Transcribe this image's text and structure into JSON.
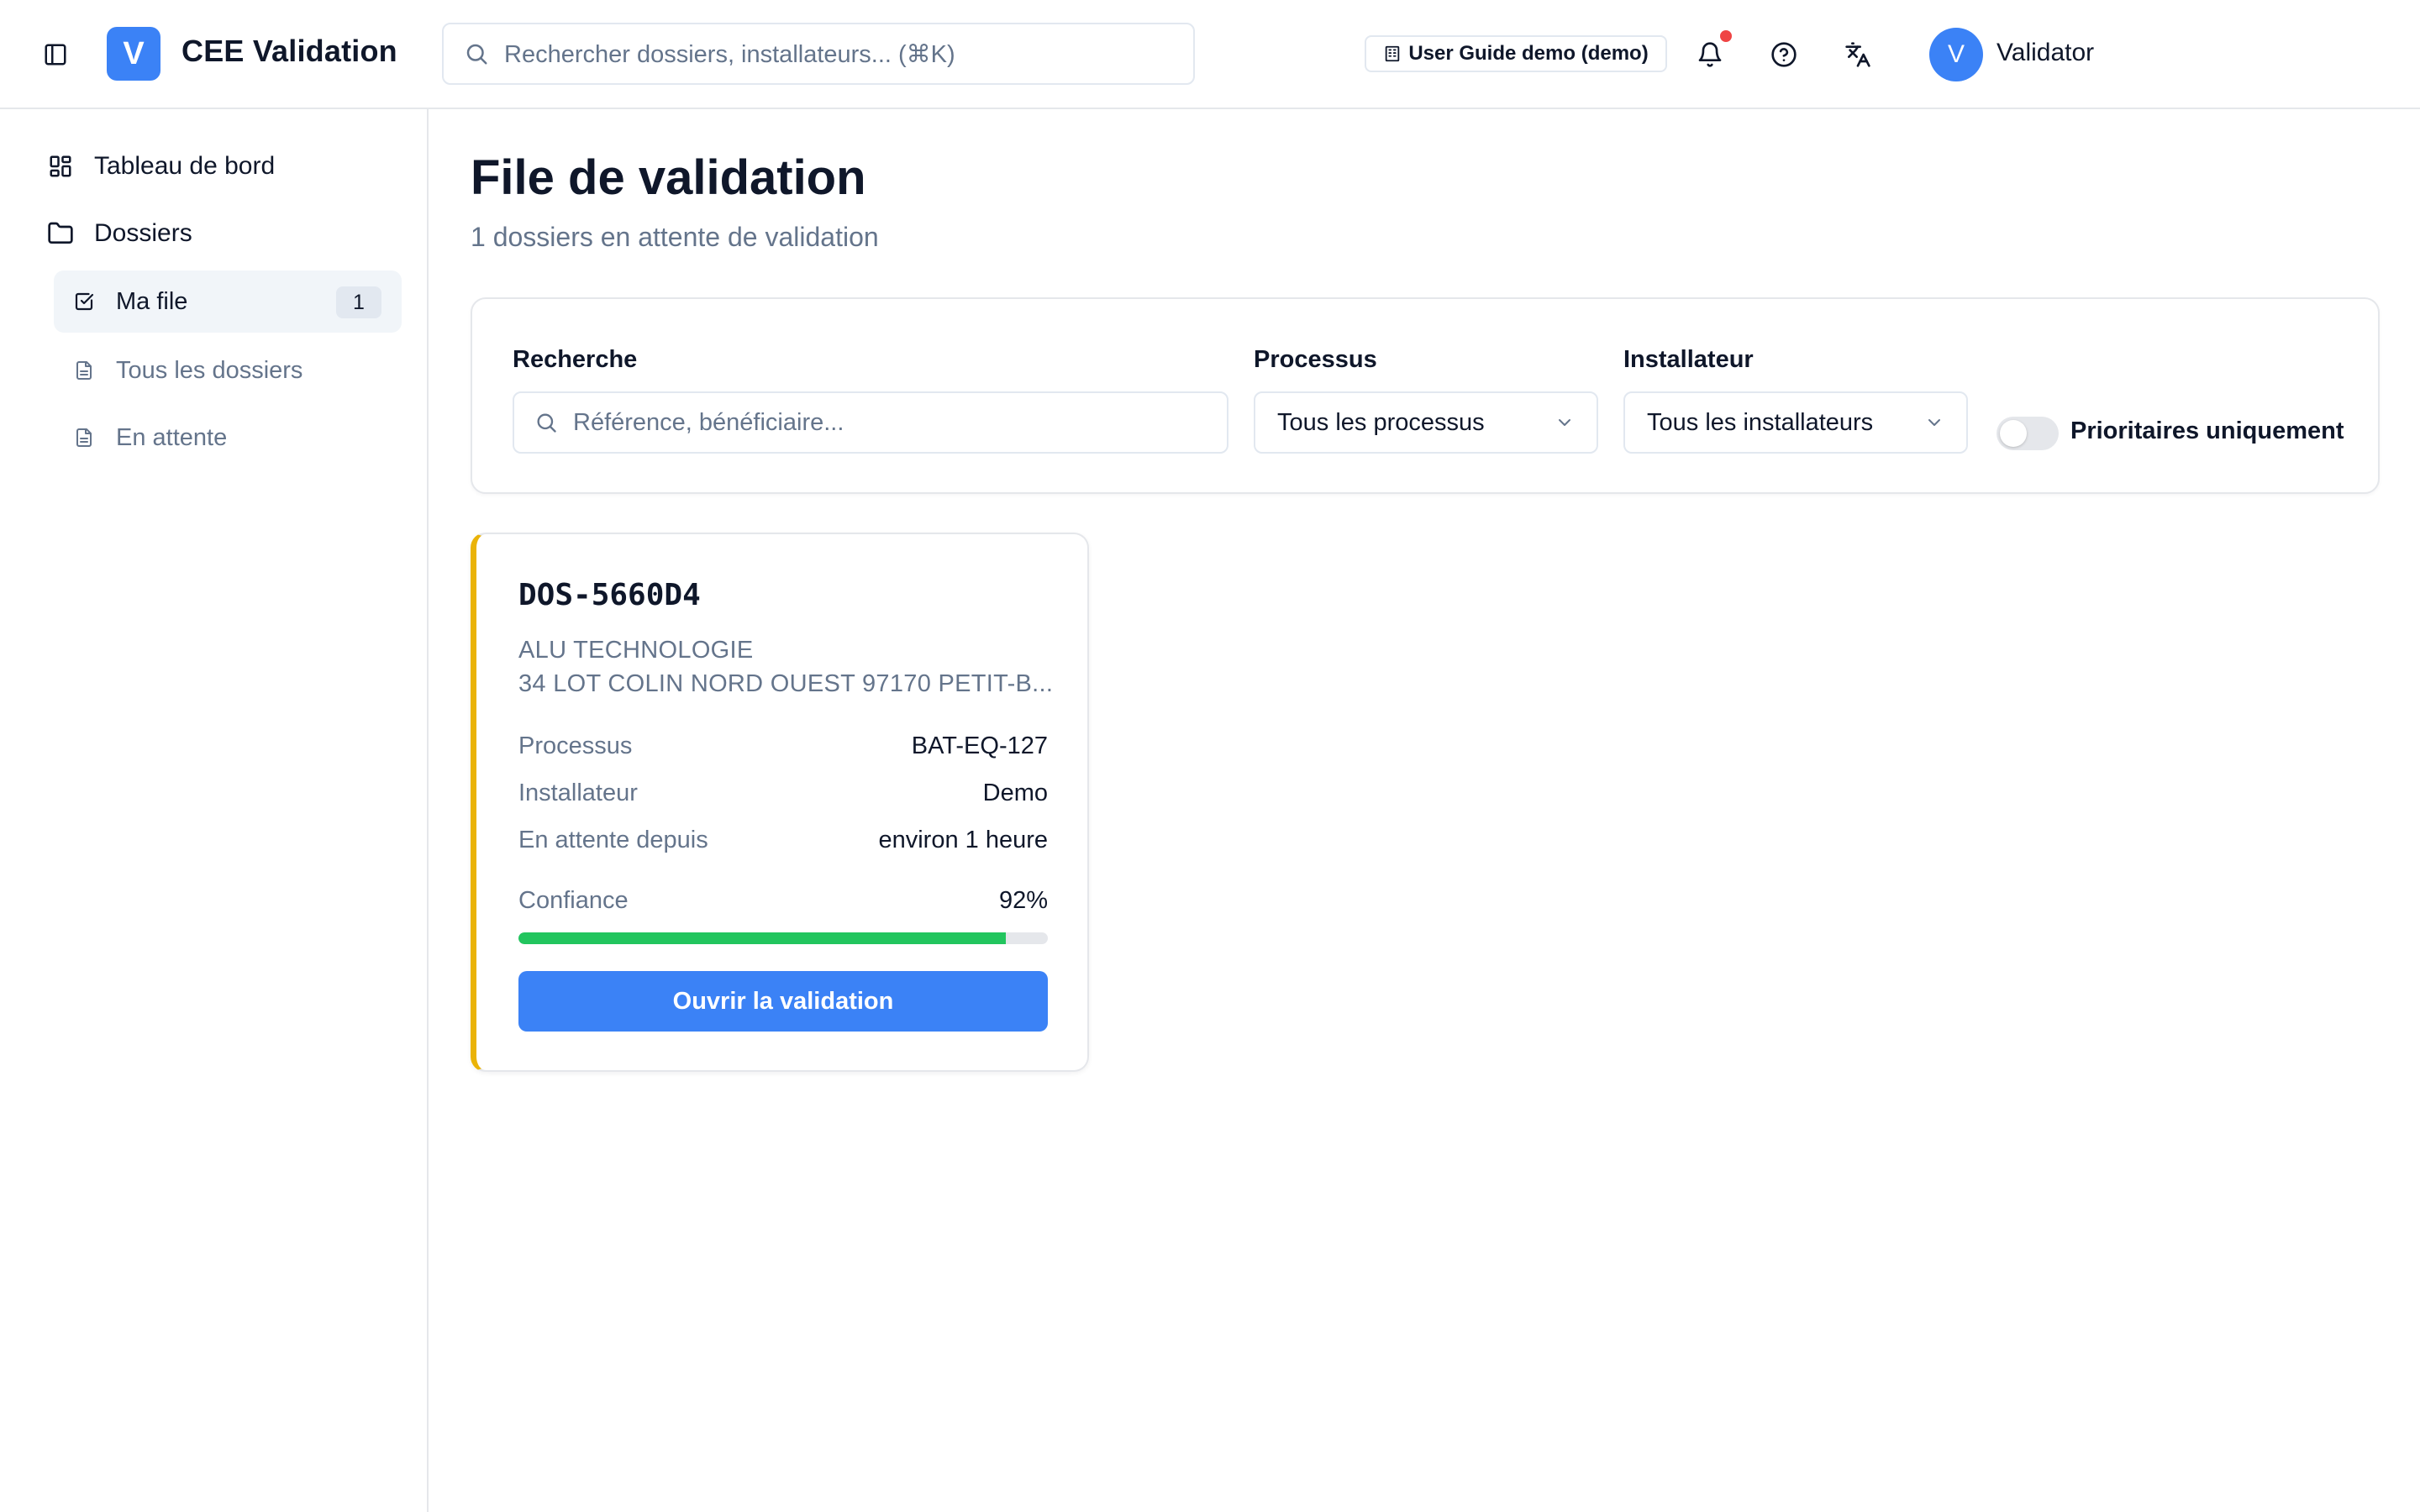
{
  "header": {
    "app_initial": "V",
    "app_title": "CEE Validation",
    "search_placeholder": "Rechercher dossiers, installateurs... (⌘K)",
    "demo_badge": "User Guide demo (demo)",
    "user_initial": "V",
    "user_name": "Validator",
    "has_notification": true
  },
  "sidebar": {
    "items": [
      {
        "label": "Tableau de bord",
        "icon": "dashboard-icon"
      },
      {
        "label": "Dossiers",
        "icon": "folder-icon"
      }
    ],
    "sub_items": [
      {
        "label": "Ma file",
        "icon": "check-square-icon",
        "count": "1",
        "active": true
      },
      {
        "label": "Tous les dossiers",
        "icon": "document-icon"
      },
      {
        "label": "En attente",
        "icon": "document-icon"
      }
    ]
  },
  "main": {
    "title": "File de validation",
    "subtitle": "1 dossiers en attente de validation"
  },
  "filters": {
    "search_label": "Recherche",
    "search_placeholder": "Référence, bénéficiaire...",
    "process_label": "Processus",
    "process_value": "Tous les processus",
    "installer_label": "Installateur",
    "installer_value": "Tous les installateurs",
    "priority_label": "Prioritaires uniquement",
    "priority_enabled": false
  },
  "cards": [
    {
      "reference": "DOS-5660D4",
      "company": "ALU TECHNOLOGIE",
      "address": "34 LOT COLIN NORD OUEST 97170 PETIT-B...",
      "process_key": "Processus",
      "process_value": "BAT-EQ-127",
      "installer_key": "Installateur",
      "installer_value": "Demo",
      "waiting_key": "En attente depuis",
      "waiting_value": "environ 1 heure",
      "confidence_key": "Confiance",
      "confidence_value": "92%",
      "confidence_fraction": 0.92,
      "button_label": "Ouvrir la validation",
      "accent_color": "#eab308"
    }
  ],
  "colors": {
    "primary": "#3b82f6",
    "progress": "#22c55e",
    "notification": "#ef4444"
  }
}
